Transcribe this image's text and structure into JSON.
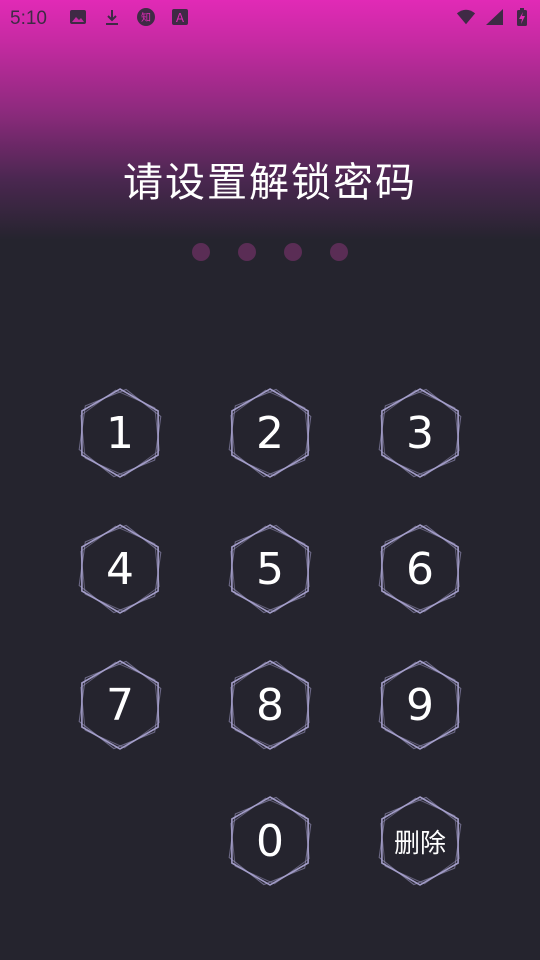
{
  "status_bar": {
    "time": "5:10",
    "icons_left": [
      "image-icon",
      "download-icon",
      "zhihu-icon",
      "font-icon"
    ],
    "icons_right": [
      "wifi-icon",
      "signal-icon",
      "battery-charging-icon"
    ]
  },
  "title": "请设置解锁密码",
  "pin_indicator": {
    "length": 4,
    "filled": 0
  },
  "keypad": {
    "keys": [
      {
        "label": "1"
      },
      {
        "label": "2"
      },
      {
        "label": "3"
      },
      {
        "label": "4"
      },
      {
        "label": "5"
      },
      {
        "label": "6"
      },
      {
        "label": "7"
      },
      {
        "label": "8"
      },
      {
        "label": "9"
      },
      {
        "label": "0"
      },
      {
        "label": "删除"
      }
    ]
  },
  "colors": {
    "header_gradient_top": "#e12ab6",
    "background": "#25242e",
    "hex_stroke": "#a8a2cf",
    "dot": "#5a2d55"
  }
}
